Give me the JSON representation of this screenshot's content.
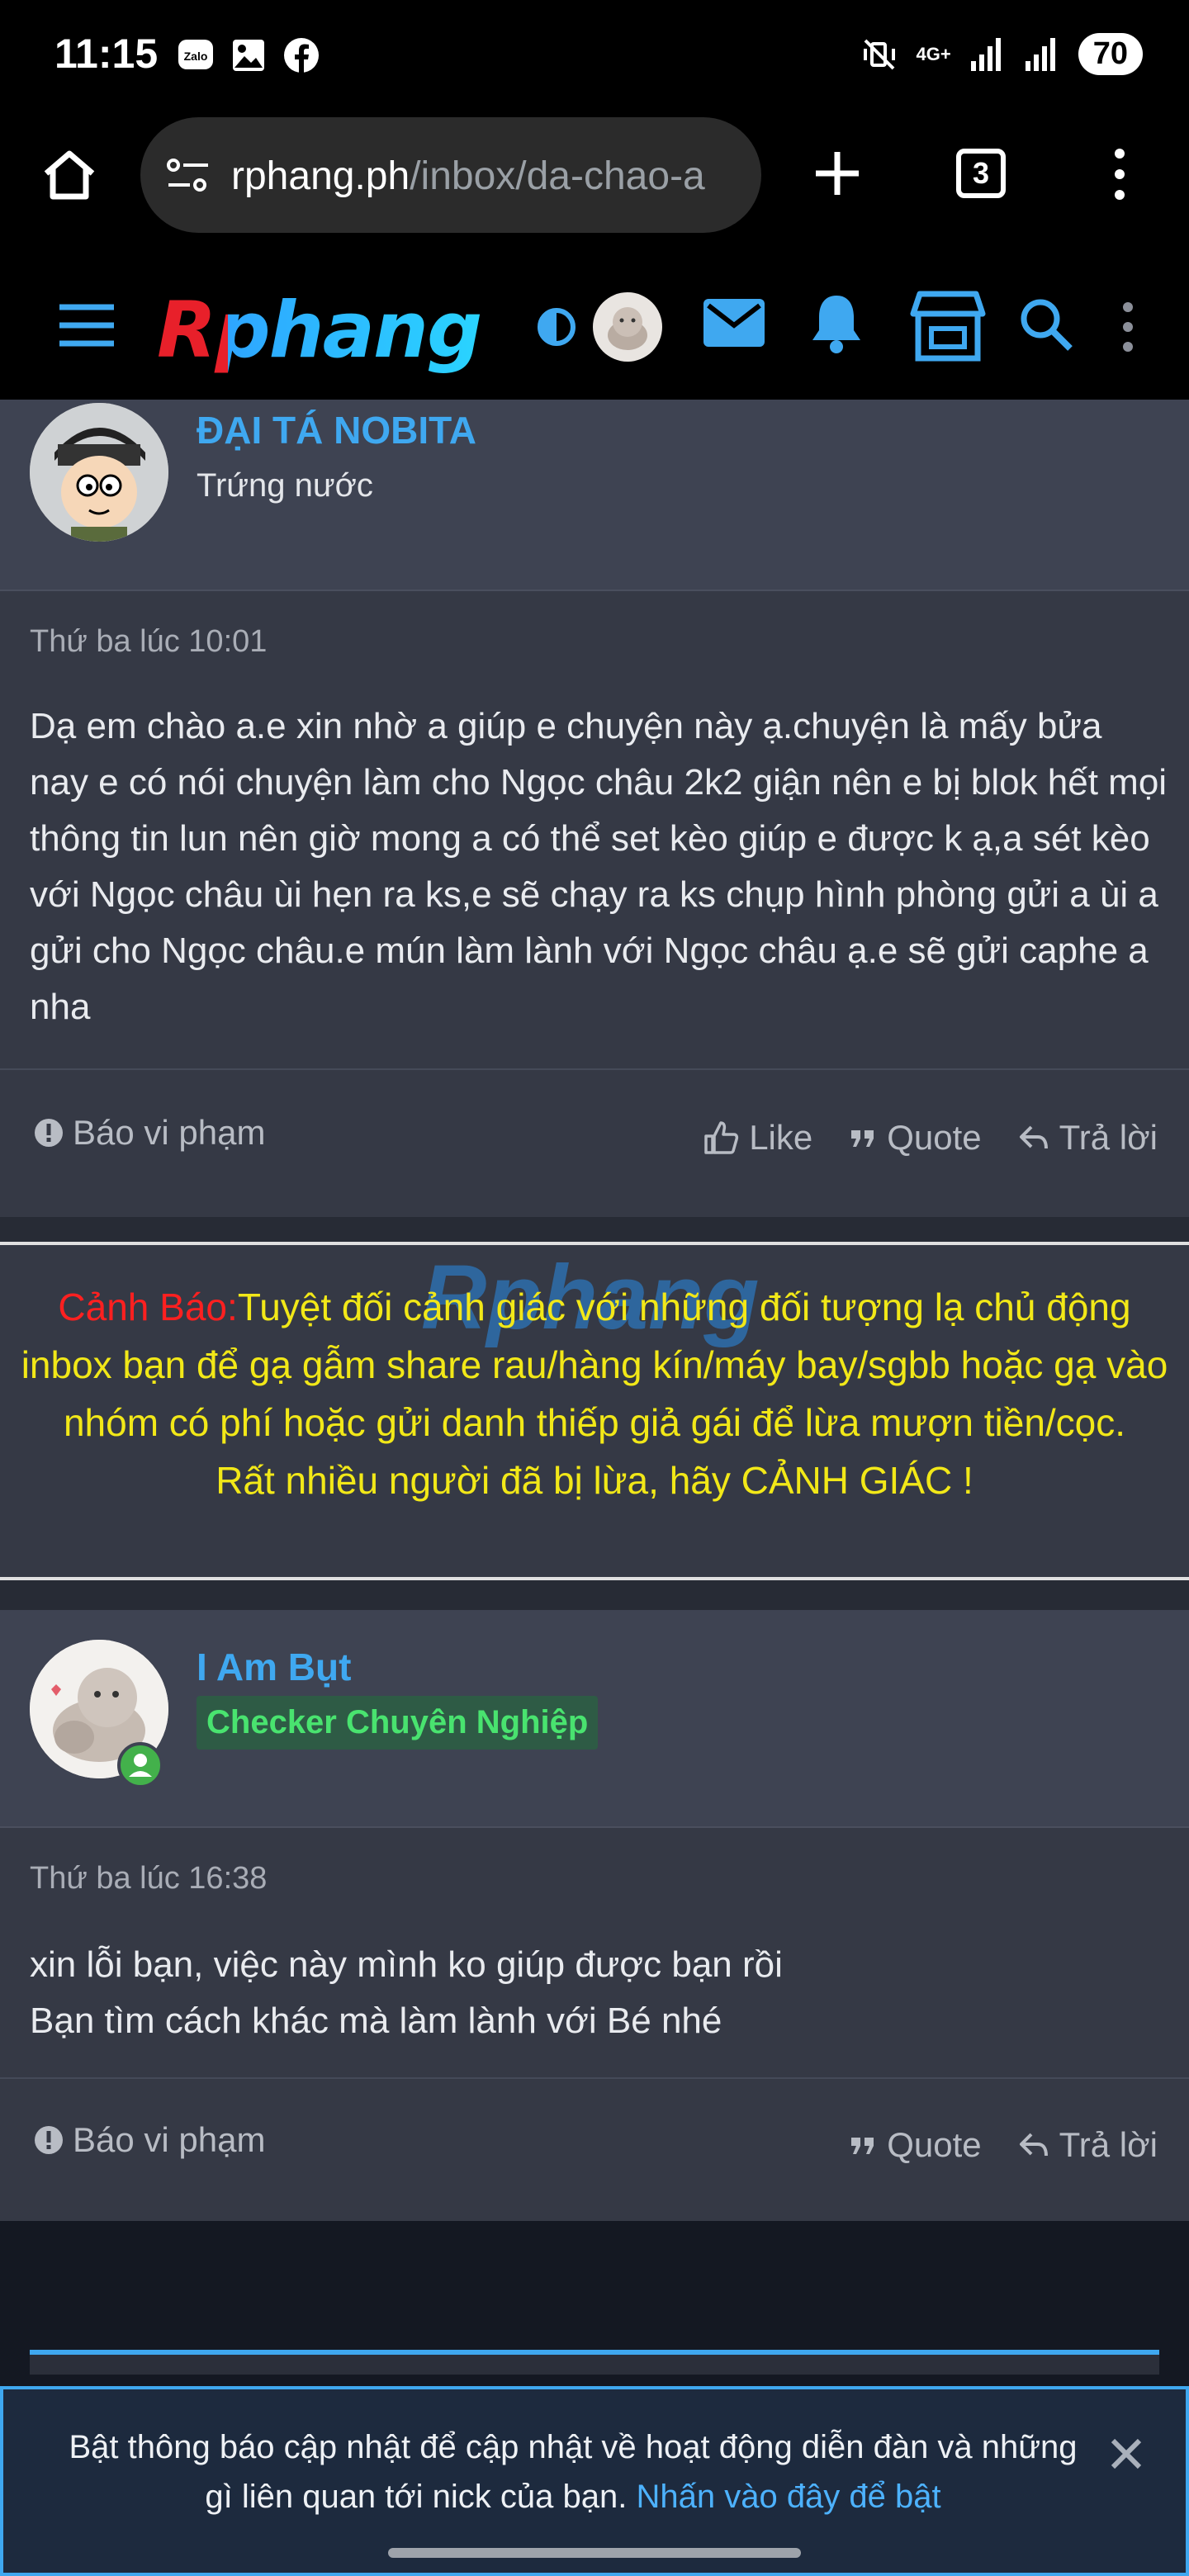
{
  "status_bar": {
    "time": "11:15",
    "left_icons": [
      "zalo-icon",
      "image-icon",
      "facebook-icon"
    ],
    "network": "4G+",
    "battery": "70"
  },
  "browser": {
    "url_domain": "rphang.ph",
    "url_path": "/inbox/da-chao-a",
    "tab_count": "3"
  },
  "site": {
    "logo": "Rphang"
  },
  "posts": [
    {
      "username": "ĐẠI TÁ NOBITA",
      "user_title": "Trứng nước",
      "date": "Thứ ba lúc 10:01",
      "content": "Dạ em chào a.e xin nhờ a giúp e chuyện này ạ.chuyện là mấy bửa nay e có nói chuyện làm cho Ngọc châu 2k2 giận nên e bị blok hết mọi thông tin lun nên giờ mong a có thể set kèo giúp e được k ạ,a sét kèo với Ngọc châu ùi hẹn ra ks,e sẽ chạy ra ks chụp hình phòng gửi a ùi a gửi cho Ngọc châu.e mún làm lành với Ngọc châu ạ.e sẽ gửi caphe a nha",
      "report": "Báo vi phạm",
      "like": "Like",
      "quote": "Quote",
      "reply": "Trả lời"
    },
    {
      "username": "I Am Bụt",
      "badge": "Checker Chuyên Nghiệp",
      "date": "Thứ ba lúc 16:38",
      "content_line1": "xin lỗi bạn, việc này mình ko giúp được bạn rồi",
      "content_line2": "Bạn tìm cách khác mà làm lành với Bé nhé",
      "report": "Báo vi phạm",
      "quote": "Quote",
      "reply": "Trả lời"
    }
  ],
  "warning": {
    "watermark": "Rphang",
    "label": "Cảnh Báo:",
    "text": "Tuyệt đối cảnh giác với những đối tượng lạ chủ động inbox bạn để gạ gẫm share rau/hàng kín/máy bay/sgbb hoặc gạ vào nhóm có phí hoặc gửi danh thiếp giả gái để lừa mượn tiền/cọc.",
    "text2": "Rất nhiều người đã bị lừa, hãy CẢNH GIÁC !"
  },
  "notification": {
    "text": "Bật thông báo cập nhật để cập nhật về hoạt động diễn đàn và những gì liên quan tới nick của bạn.",
    "link": "Nhấn vào đây để bật"
  }
}
